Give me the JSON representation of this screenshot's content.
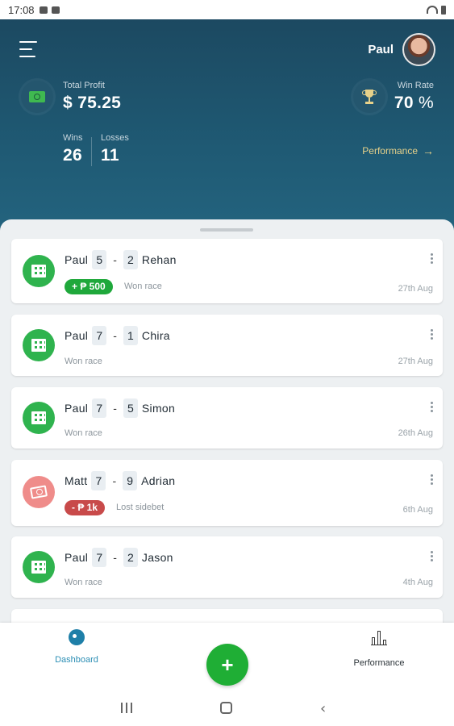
{
  "status_bar": {
    "time": "17:08"
  },
  "header": {
    "user_name": "Paul",
    "total_profit_label": "Total Profit",
    "total_profit_value": "$ 75.25",
    "win_rate_label": "Win Rate",
    "win_rate_value": "70",
    "win_rate_unit": "%",
    "wins_label": "Wins",
    "wins_value": "26",
    "losses_label": "Losses",
    "losses_value": "11",
    "performance_link": "Performance"
  },
  "cards": [
    {
      "player1": "Paul",
      "score1": "5",
      "score2": "2",
      "player2": "Rehan",
      "pill": "+ ₱ 500",
      "result": "Won race",
      "date": "27th Aug"
    },
    {
      "player1": "Paul",
      "score1": "7",
      "score2": "1",
      "player2": "Chira",
      "result": "Won race",
      "date": "27th Aug"
    },
    {
      "player1": "Paul",
      "score1": "7",
      "score2": "5",
      "player2": "Simon",
      "result": "Won race",
      "date": "26th Aug"
    },
    {
      "player1": "Matt",
      "score1": "7",
      "score2": "9",
      "player2": "Adrian",
      "pill": "- ₱ 1k",
      "result": "Lost sidebet",
      "date": "6th Aug"
    },
    {
      "player1": "Paul",
      "score1": "7",
      "score2": "2",
      "player2": "Jason",
      "result": "Won race",
      "date": "4th Aug"
    }
  ],
  "bottom_nav": {
    "dashboard_label": "Dashboard",
    "performance_label": "Performance",
    "fab_label": "+"
  },
  "colors": {
    "win": "#2fb34e",
    "loss": "#ef8c8a",
    "accent": "#1fae35",
    "header_bg": "#1f5a74",
    "link_gold": "#e7d18a"
  }
}
